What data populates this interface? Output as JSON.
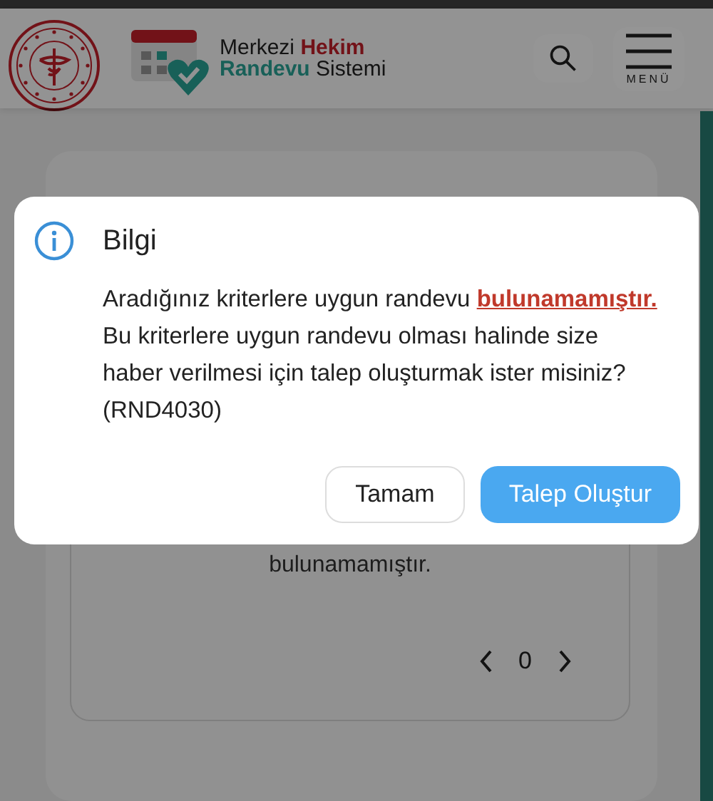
{
  "header": {
    "brand": {
      "line_1": [
        {
          "text": "Merkezi",
          "color": "#131313"
        },
        {
          "text": "Hekim",
          "color": "#721218"
        }
      ],
      "line_2": [
        {
          "text": "Randevu",
          "color": "#186058"
        },
        {
          "text": "Sistemi",
          "color": "#131313"
        }
      ]
    },
    "menu_button": {
      "label": "MENÜ"
    }
  },
  "background_card": {
    "message": "bulunamamıştır.",
    "pager": {
      "page": "0"
    }
  },
  "dialog": {
    "title": "Bilgi",
    "message": [
      "Aradığınız kriterlere uygun randevu **bulunamamıştır.**",
      "Bu kriterlere uygun randevu olması halinde size",
      "haber verilmesi için talep oluşturmak ister misiniz?",
      "(RND4030)"
    ],
    "buttons": [
      {
        "label": "Tamam",
        "kind": "secondary"
      },
      {
        "label": "Talep Oluştur",
        "kind": "primary"
      }
    ]
  }
}
